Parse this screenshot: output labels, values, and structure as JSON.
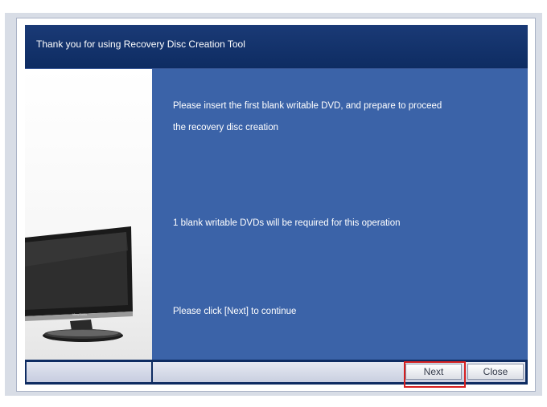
{
  "window": {
    "title": "Thank you for using Recovery Disc Creation Tool"
  },
  "messages": {
    "line1": "Please insert the first blank writable DVD, and prepare to proceed",
    "line2": "the recovery disc creation",
    "required": "1 blank writable DVDs will be required for this operation",
    "continue": "Please click [Next] to continue"
  },
  "buttons": {
    "next": "Next",
    "close": "Close"
  },
  "illustration": {
    "brand": "ViewSonic"
  },
  "colors": {
    "title_bar": "#0e2c62",
    "content_panel": "#3b63a8",
    "highlight": "#d61f1f"
  }
}
